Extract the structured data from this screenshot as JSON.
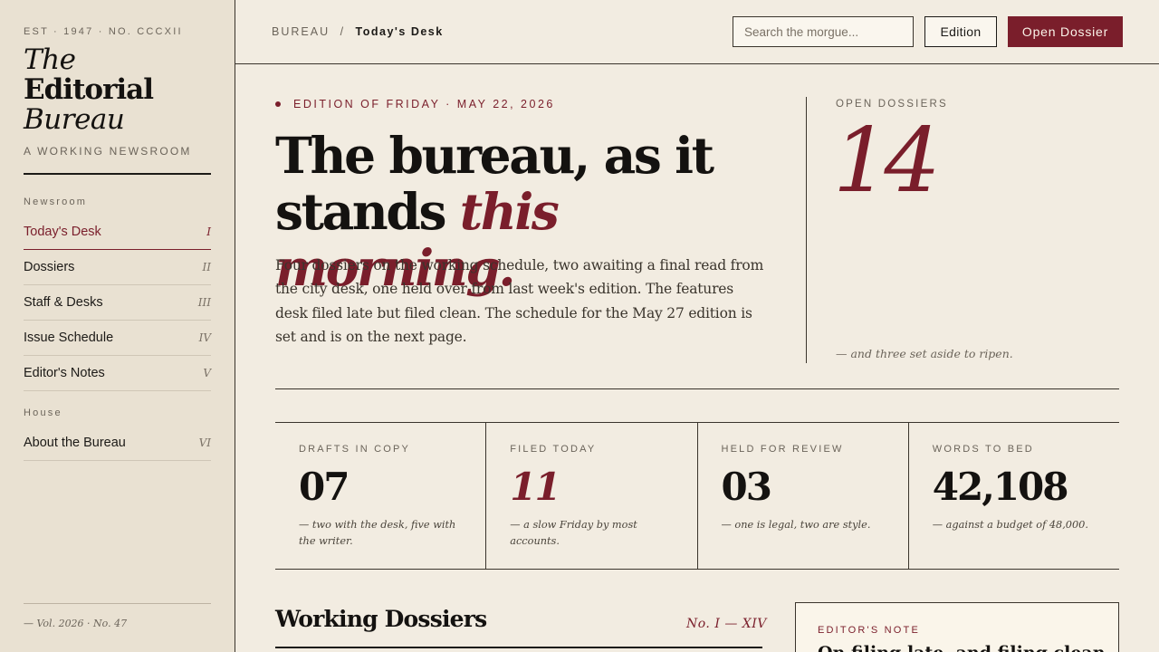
{
  "sidebar": {
    "est": "EST · 1947 · NO. CCCXII",
    "logo": {
      "line1": "The",
      "line2": "Editorial",
      "line3": "Bureau"
    },
    "tagline": "A WORKING NEWSROOM",
    "sections": [
      {
        "title": "Newsroom",
        "items": [
          {
            "label": "Today's Desk",
            "num": "I",
            "active": true
          },
          {
            "label": "Dossiers",
            "num": "II"
          },
          {
            "label": "Staff & Desks",
            "num": "III"
          },
          {
            "label": "Issue Schedule",
            "num": "IV"
          },
          {
            "label": "Editor's Notes",
            "num": "V"
          }
        ]
      },
      {
        "title": "House",
        "items": [
          {
            "label": "About the Bureau",
            "num": "VI"
          }
        ]
      }
    ],
    "footer": "— Vol. 2026 · No. 47"
  },
  "topbar": {
    "breadcrumb_root": "BUREAU",
    "breadcrumb_sep": "/",
    "breadcrumb_current": "Today's Desk",
    "search_placeholder": "Search the morgue...",
    "edition_label": "Edition",
    "open_dossier_label": "Open Dossier"
  },
  "hero": {
    "kicker": "EDITION OF FRIDAY · MAY 22, 2026",
    "headline_plain": "The bureau, as it stands ",
    "headline_accent": "this morning.",
    "lede": "Four dossiers on the working schedule, two awaiting a final read from the city desk, one held over from last week's edition. The features desk filed late but filed clean. The schedule for the May 27 edition is set and is on the next page.",
    "open_dossiers_label": "OPEN DOSSIERS",
    "open_dossiers_value": "14",
    "open_dossiers_note": "— and three set aside to ripen."
  },
  "stats": [
    {
      "label": "DRAFTS IN COPY",
      "value": "07",
      "note": "— two with the desk, five with the writer.",
      "accent": false
    },
    {
      "label": "FILED TODAY",
      "value": "11",
      "note": "— a slow Friday by most accounts.",
      "accent": true
    },
    {
      "label": "HELD FOR REVIEW",
      "value": "03",
      "note": "— one is legal, two are style.",
      "accent": false
    },
    {
      "label": "WORDS TO BED",
      "value": "42,108",
      "note": "— against a budget of 48,000.",
      "accent": false
    }
  ],
  "dossiers": {
    "title": "Working Dossiers",
    "range": "No. I — XIV"
  },
  "editors_note": {
    "label": "EDITOR'S NOTE",
    "text": "On filing late, and filing clean"
  },
  "colors": {
    "accent": "#7a1e2b",
    "paper": "#f2ece1",
    "sidebar": "#e9e1d2",
    "ink": "#1c1a17"
  }
}
